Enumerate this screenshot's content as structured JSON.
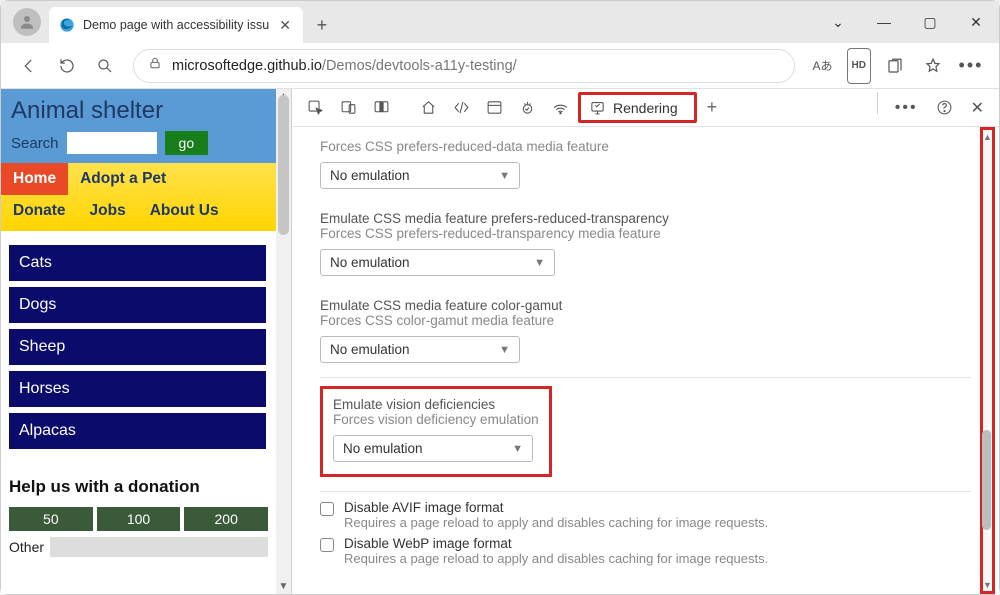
{
  "tab": {
    "title": "Demo page with accessibility issu"
  },
  "url": {
    "domain": "microsoftedge.github.io",
    "path": "/Demos/devtools-a11y-testing/"
  },
  "urlbar_icons": {
    "reader": "Aあ",
    "hd": "HD"
  },
  "page": {
    "title": "Animal shelter",
    "search_label": "Search",
    "go": "go",
    "nav": [
      "Home",
      "Adopt a Pet",
      "Donate",
      "Jobs",
      "About Us"
    ],
    "cats": [
      "Cats",
      "Dogs",
      "Sheep",
      "Horses",
      "Alpacas"
    ],
    "donate_title": "Help us with a donation",
    "amounts": [
      "50",
      "100",
      "200"
    ],
    "other": "Other"
  },
  "devtools": {
    "rendering_tab": "Rendering",
    "sections": [
      {
        "sub": "Forces CSS prefers-reduced-data media feature",
        "value": "No emulation"
      },
      {
        "title": "Emulate CSS media feature prefers-reduced-transparency",
        "sub": "Forces CSS prefers-reduced-transparency media feature",
        "value": "No emulation"
      },
      {
        "title": "Emulate CSS media feature color-gamut",
        "sub": "Forces CSS color-gamut media feature",
        "value": "No emulation"
      },
      {
        "title": "Emulate vision deficiencies",
        "sub": "Forces vision deficiency emulation",
        "value": "No emulation"
      }
    ],
    "checks": [
      {
        "t1": "Disable AVIF image format",
        "t2": "Requires a page reload to apply and disables caching for image requests."
      },
      {
        "t1": "Disable WebP image format",
        "t2": "Requires a page reload to apply and disables caching for image requests."
      }
    ]
  }
}
